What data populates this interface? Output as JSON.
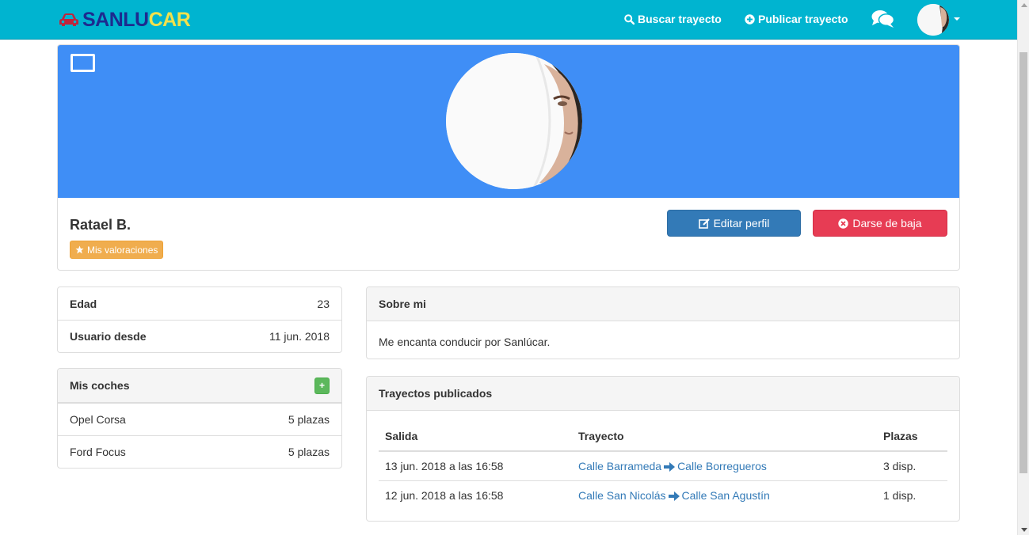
{
  "brand": {
    "part1": "SANLU",
    "part2": "CAR",
    "colors": {
      "part1": "#1d2b8f",
      "part2": "#f2e14c",
      "icon": "#c0243c"
    }
  },
  "nav": {
    "search_label": "Buscar trayecto",
    "publish_label": "Publicar trayecto",
    "icons": {
      "search": "search-icon",
      "publish": "plus-circle-icon",
      "chat": "comments-icon"
    }
  },
  "profile": {
    "name": "Ratael B.",
    "ratings_label": "Mis valoraciones",
    "edit_label": "Editar perfil",
    "delete_label": "Darse de baja",
    "colors": {
      "cover": "#3f8ef6",
      "edit": "#337ab7",
      "delete": "#e73c54",
      "ratings": "#f0ad4e"
    }
  },
  "info": [
    {
      "label": "Edad",
      "value": "23"
    },
    {
      "label": "Usuario desde",
      "value": "11 jun. 2018"
    }
  ],
  "cars": {
    "title": "Mis coches",
    "add_label": "+",
    "items": [
      {
        "name": "Opel Corsa",
        "seats": "5 plazas"
      },
      {
        "name": "Ford Focus",
        "seats": "5 plazas"
      }
    ]
  },
  "about": {
    "title": "Sobre mi",
    "text": "Me encanta conducir por Sanlúcar."
  },
  "trips": {
    "title": "Trayectos publicados",
    "columns": [
      "Salida",
      "Trayecto",
      "Plazas"
    ],
    "rows": [
      {
        "salida": "13 jun. 2018 a las 16:58",
        "origin": "Calle Barrameda",
        "destination": "Calle Borregueros",
        "plazas": "3 disp."
      },
      {
        "salida": "12 jun. 2018 a las 16:58",
        "origin": "Calle San Nicolás",
        "destination": "Calle San Agustín",
        "plazas": "1 disp."
      }
    ]
  }
}
